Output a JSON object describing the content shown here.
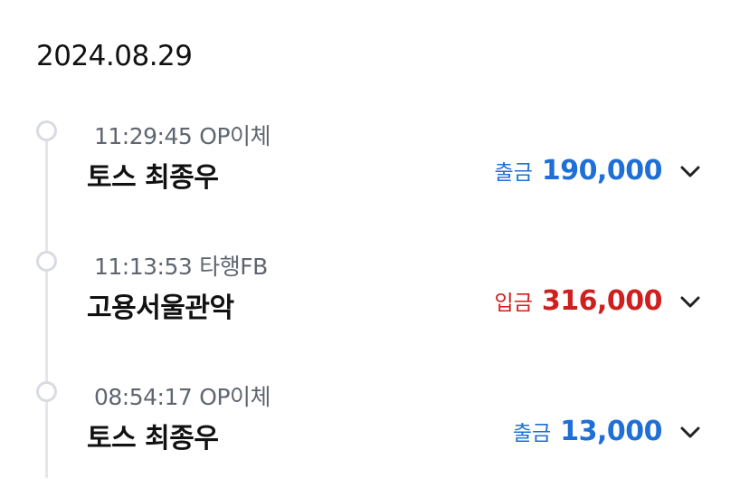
{
  "date": "2024.08.29",
  "colors": {
    "withdrawal": "#1f6fd6",
    "deposit": "#cf1f1f",
    "timeline": "#e4e6ea"
  },
  "transactions": [
    {
      "time": "11:29:45",
      "channel": "OP이체",
      "name": "토스 최종우",
      "type": "출금",
      "amount": "190,000",
      "icon": "chevron-down-icon"
    },
    {
      "time": "11:13:53",
      "channel": "타행FB",
      "name": "고용서울관악",
      "type": "입금",
      "amount": "316,000",
      "icon": "chevron-down-icon"
    },
    {
      "time": "08:54:17",
      "channel": "OP이체",
      "name": "토스 최종우",
      "type": "출금",
      "amount": "13,000",
      "icon": "chevron-down-icon"
    }
  ]
}
